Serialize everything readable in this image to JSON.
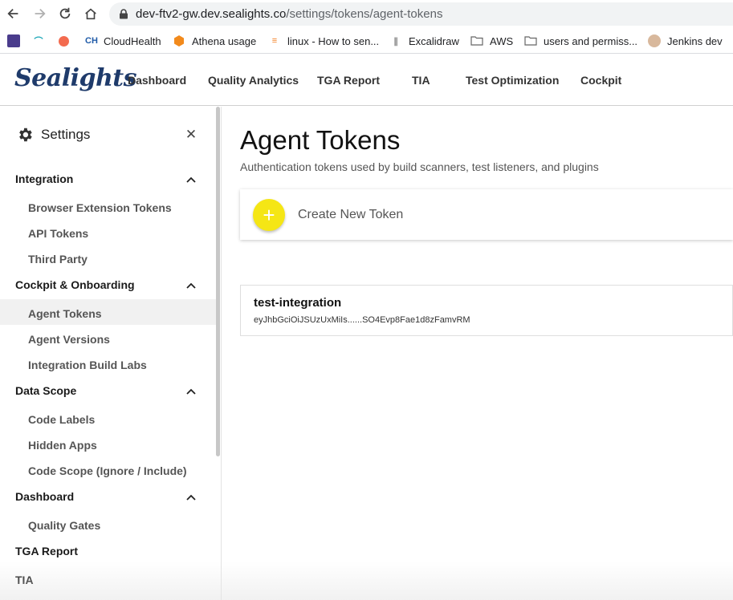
{
  "browser": {
    "url_host": "dev-ftv2-gw.dev.sealights.co",
    "url_path": "/settings/tokens/agent-tokens",
    "bookmarks": [
      {
        "label": "",
        "icon": "app-icon"
      },
      {
        "label": "",
        "icon": "lasso-icon"
      },
      {
        "label": "",
        "icon": "speech-bubble-icon"
      },
      {
        "label": "CloudHealth",
        "icon": "ch-icon"
      },
      {
        "label": "Athena usage",
        "icon": "athena-icon"
      },
      {
        "label": "linux - How to sen...",
        "icon": "stackoverflow-icon"
      },
      {
        "label": "Excalidraw",
        "icon": "excalidraw-icon"
      },
      {
        "label": "AWS",
        "icon": "folder-icon"
      },
      {
        "label": "users and permiss...",
        "icon": "folder-icon"
      },
      {
        "label": "Jenkins dev",
        "icon": "jenkins-icon"
      }
    ]
  },
  "header": {
    "logo": "Sealights",
    "nav": [
      "Dashboard",
      "Quality Analytics",
      "TGA Report",
      "TIA",
      "Test Optimization",
      "Cockpit"
    ]
  },
  "sidebar": {
    "title": "Settings",
    "sections": [
      {
        "label": "Integration",
        "items": [
          "Browser Extension Tokens",
          "API Tokens",
          "Third Party"
        ]
      },
      {
        "label": "Cockpit & Onboarding",
        "items": [
          "Agent Tokens",
          "Agent Versions",
          "Integration Build Labs"
        ]
      },
      {
        "label": "Data Scope",
        "items": [
          "Code Labels",
          "Hidden Apps",
          "Code Scope (Ignore / Include)"
        ]
      },
      {
        "label": "Dashboard",
        "items": [
          "Quality Gates"
        ]
      },
      {
        "label": "TGA Report",
        "items": []
      },
      {
        "label": "TIA",
        "items": []
      }
    ],
    "active_item": "Agent Tokens"
  },
  "main": {
    "title": "Agent Tokens",
    "subtitle": "Authentication tokens used by build scanners, test listeners, and plugins",
    "create_label": "Create New Token",
    "plus": "+",
    "tokens": [
      {
        "name": "test-integration",
        "value": "eyJhbGciOiJSUzUxMiIs......SO4Evp8Fae1d8zFamvRM"
      }
    ]
  },
  "colors": {
    "accent_yellow": "#f5e615",
    "logo_blue": "#1f3b6b"
  }
}
